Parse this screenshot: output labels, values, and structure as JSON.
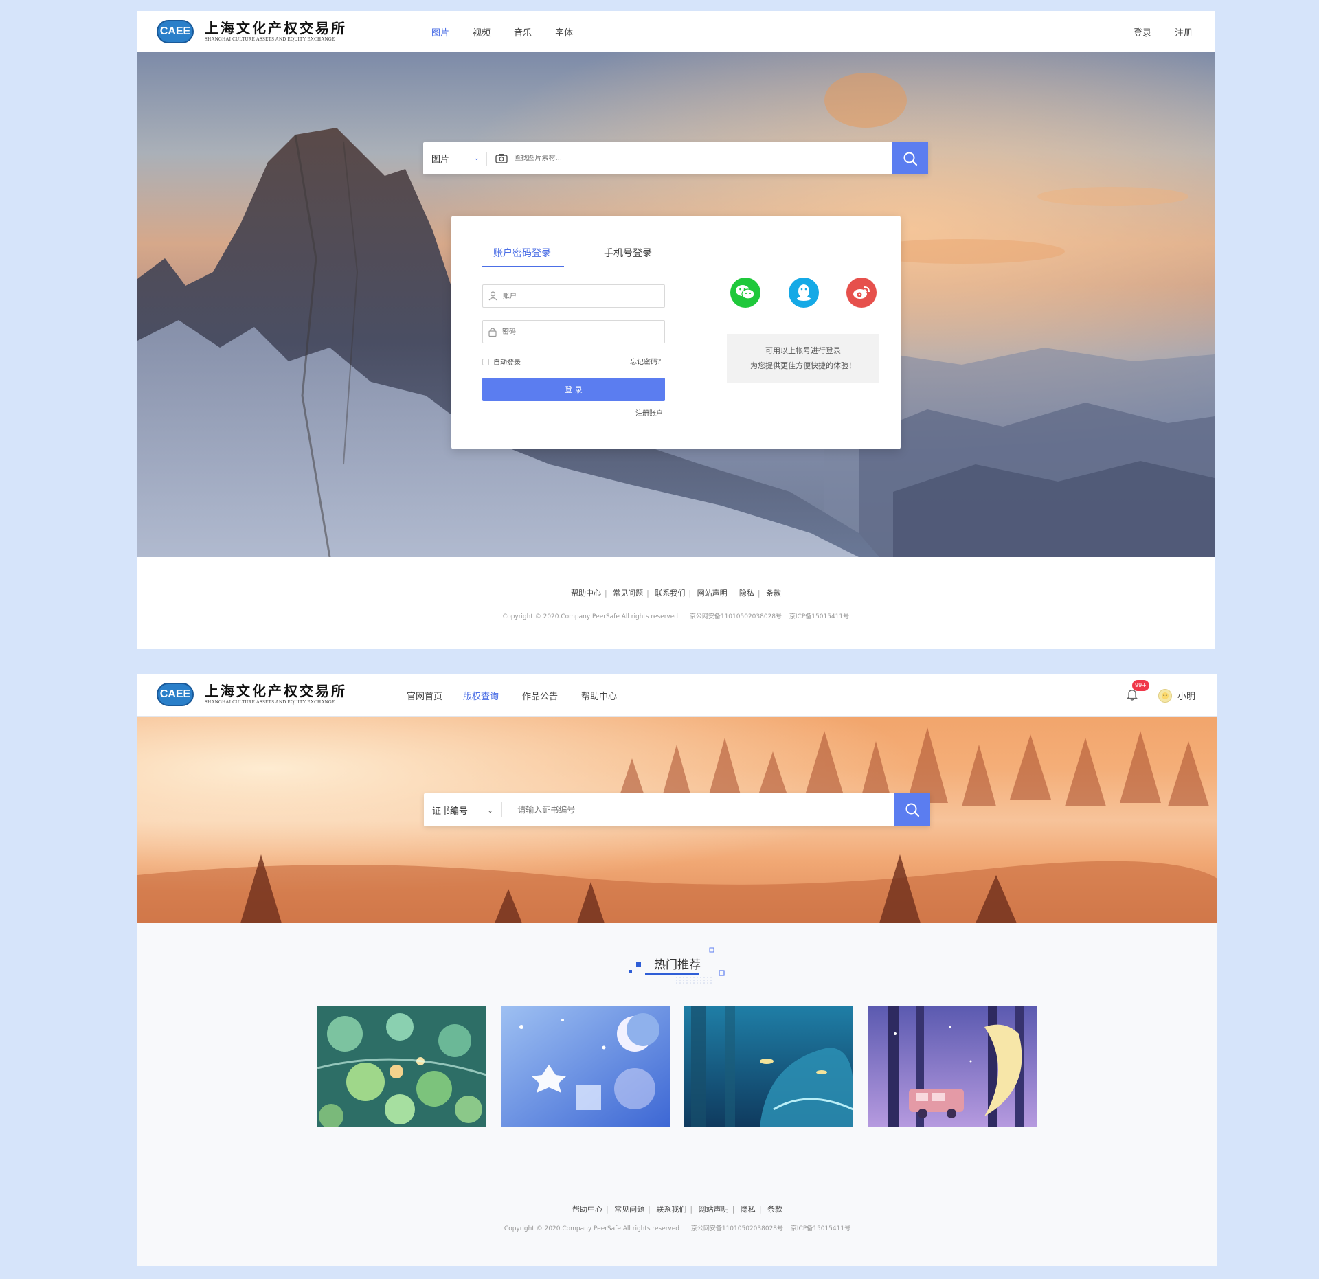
{
  "brand": {
    "badge": "CAEE",
    "name_cn": "上海文化产权交易所",
    "name_en": "SHANGHAI CULTURE ASSETS AND EQUITY EXCHANGE"
  },
  "page1": {
    "nav": [
      "图片",
      "视频",
      "音乐",
      "字体"
    ],
    "nav_active": "图片",
    "login_link": "登录",
    "register_link": "注册",
    "search": {
      "category": "图片",
      "placeholder": "查找图片素材..."
    },
    "login_card": {
      "tab_password": "账户密码登录",
      "tab_phone": "手机号登录",
      "account_placeholder": "账户",
      "password_placeholder": "密码",
      "auto_login": "自动登录",
      "forgot": "忘记密码？",
      "submit": "登 录",
      "register_account": "注册账户",
      "social": [
        "wechat-icon",
        "qq-icon",
        "weibo-icon"
      ],
      "social_note_1": "可用以上帐号进行登录",
      "social_note_2": "为您提供更佳方便快捷的体验！"
    },
    "footer": {
      "links": [
        "帮助中心",
        "常见问题",
        "联系我们",
        "网站声明",
        "隐私",
        "条款"
      ],
      "copyright": "Copyright © 2020.Company PeerSafe All rights reserved",
      "beian": "京公网安备11010502038028号",
      "icp": "京ICP备15015411号"
    }
  },
  "page2": {
    "nav": [
      "官网首页",
      "版权查询",
      "作品公告",
      "帮助中心"
    ],
    "nav_active": "版权查询",
    "notification_badge": "99+",
    "username": "小明",
    "search": {
      "category": "证书编号",
      "placeholder": "请输入证书编号"
    },
    "section_title": "热门推荐",
    "footer": {
      "links": [
        "帮助中心",
        "常见问题",
        "联系我们",
        "网站声明",
        "隐私",
        "条款"
      ],
      "copyright": "Copyright © 2020.Company PeerSafe All rights reserved",
      "beian": "京公网安备11010502038028号",
      "icp": "京ICP备15015411号"
    }
  },
  "colors": {
    "accent": "#4c6fe6",
    "search_button": "#5b7df0",
    "wechat": "#1fc83b",
    "qq": "#15a9e6",
    "weibo": "#e6504c",
    "badge_red": "#f0384a"
  }
}
